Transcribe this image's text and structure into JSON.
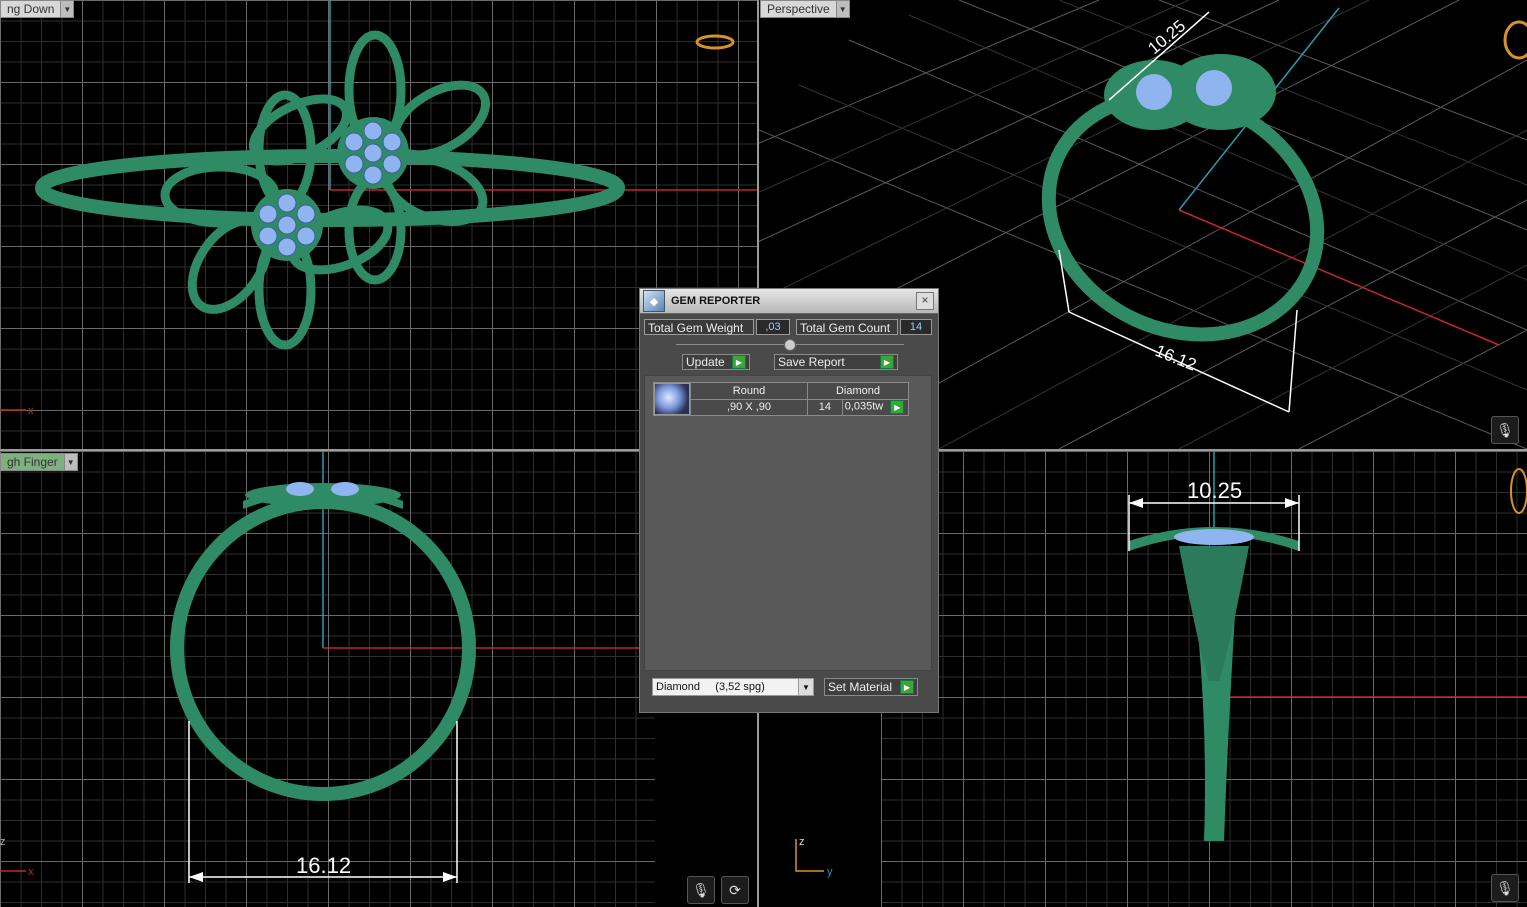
{
  "viewports": {
    "top_left": {
      "label": "ng Down"
    },
    "top_right": {
      "label": "Perspective"
    },
    "bottom_left": {
      "label": "gh Finger"
    },
    "bottom_right": {
      "label": ""
    }
  },
  "dimensions": {
    "width_label": "10.25",
    "ring_label": "16.12"
  },
  "axes": {
    "x": "x",
    "y": "y",
    "z": "z"
  },
  "gem_reporter": {
    "title": "GEM REPORTER",
    "close": "×",
    "total_weight_label": "Total Gem Weight",
    "total_weight_value": ",03",
    "total_count_label": "Total Gem Count",
    "total_count_value": "14",
    "update_label": "Update",
    "save_report_label": "Save Report",
    "gems": [
      {
        "shape": "Round",
        "size": ",90 X ,90",
        "material": "Diamond",
        "count": "14",
        "weight": "0,035tw"
      }
    ],
    "material_select": "Diamond     (3,52 spg)",
    "set_material_label": "Set Material"
  },
  "colors": {
    "ring": "#2f8a66",
    "gem": "#8fb4ef",
    "axis_red": "#c0282a",
    "axis_cyan": "#2a9ab0"
  },
  "icons": [
    "microphone-icon",
    "refresh-icon"
  ]
}
